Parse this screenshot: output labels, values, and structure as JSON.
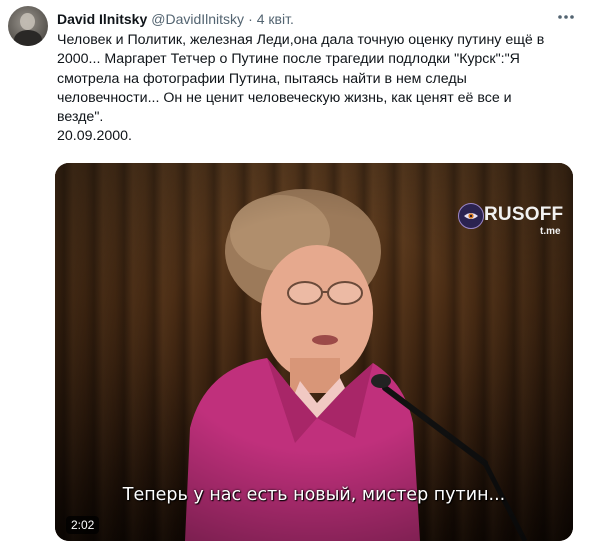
{
  "tweet": {
    "author_name": "David Ilnitsky",
    "author_handle": "@DavidIlnitsky",
    "separator": "·",
    "time": "4 квіт.",
    "text_lines": [
      "Человек и Политик, железная Леди,она дала точную оценку путину ещё в",
      "2000... Маргарет Тетчер о Путине после трагедии подлодки \"Курск\":\"Я",
      "смотрела на фотографии Путина, пытаясь найти в нем следы",
      "человечности... Он не ценит человеческую жизнь, как ценят её все и",
      "везде\".",
      "20.09.2000."
    ]
  },
  "media": {
    "logo_text": "RUSOFF",
    "logo_subtext": "t.me",
    "subtitle": "Теперь у нас есть новый, мистер путин...",
    "duration": "2:02"
  },
  "icons": {
    "more": "more-options-icon",
    "logo_eye": "eye-icon"
  },
  "colors": {
    "text_primary": "#0f1419",
    "text_secondary": "#536471",
    "jacket": "#c0307c"
  }
}
